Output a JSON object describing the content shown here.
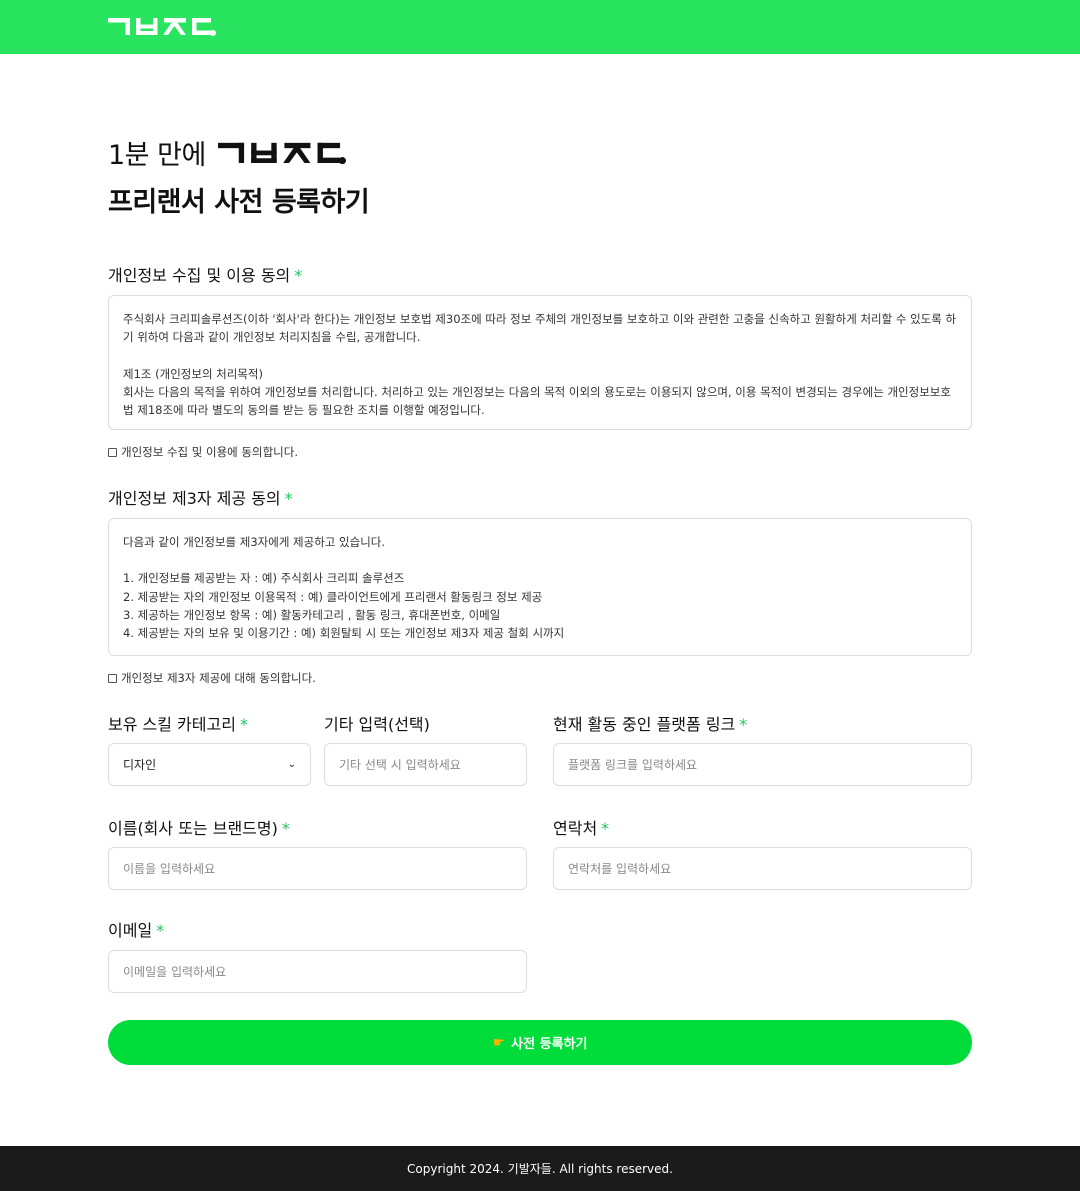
{
  "brand": {
    "logo_alt": "기발자들",
    "accent_color": "#28e45f",
    "button_color": "#00dd3a",
    "required_color": "#22c55e"
  },
  "headline": {
    "line1_prefix": "1분 만에",
    "line2": "프리랜서 사전 등록하기"
  },
  "privacy_consent": {
    "title": "개인정보 수집 및 이용 동의",
    "required_mark": "*",
    "text": "주식회사 크리피솔루션즈(이하 '회사'라 한다)는 개인정보 보호법 제30조에 따라 정보 주체의 개인정보를 보호하고 이와 관련한 고충을 신속하고 원활하게 처리할 수 있도록 하기 위하여 다음과 같이 개인정보 처리지침을 수립, 공개합니다.\n\n제1조 (개인정보의 처리목적)\n회사는 다음의 목적을 위하여 개인정보를 처리합니다. 처리하고 있는 개인정보는 다음의 목적 이외의 용도로는 이용되지 않으며, 이용 목적이 변경되는 경우에는 개인정보보호법 제18조에 따라 별도의 동의를 받는 등 필요한 조치를 이행할 예정입니다.",
    "checkbox_label": "개인정보 수집 및 이용에 동의합니다."
  },
  "third_party_consent": {
    "title": "개인정보 제3자 제공 동의",
    "required_mark": "*",
    "text": "다음과 같이 개인정보를 제3자에게 제공하고 있습니다.\n\n1. 개인정보를 제공받는 자 : 예) 주식회사 크리피 솔루션즈\n2. 제공받는 자의 개인정보 이용목적 : 예) 클라이언트에게 프리랜서 활동링크 정보 제공\n3. 제공하는 개인정보 항목 : 예) 활동카테고리 , 활동 링크, 휴대폰번호, 이메일\n4. 제공받는 자의 보유 및 이용기간 : 예) 회원탈퇴 시 또는 개인정보 제3자 제공 철회 시까지",
    "checkbox_label": "개인정보 제3자 제공에 대해 동의합니다."
  },
  "form": {
    "skill_category": {
      "label": "보유 스킬 카테고리",
      "required_mark": "*",
      "selected": "디자인"
    },
    "other_input": {
      "label": "기타 입력(선택)",
      "placeholder": "기타 선택 시 입력하세요"
    },
    "platform_link": {
      "label": "현재 활동 중인 플랫폼 링크",
      "required_mark": "*",
      "placeholder": "플랫폼 링크를 입력하세요"
    },
    "name": {
      "label": "이름(회사 또는 브랜드명)",
      "required_mark": "*",
      "placeholder": "이름을 입력하세요"
    },
    "contact": {
      "label": "연락처",
      "required_mark": "*",
      "placeholder": "연락처를 입력하세요"
    },
    "email": {
      "label": "이메일",
      "required_mark": "*",
      "placeholder": "이메일을 입력하세요"
    }
  },
  "submit": {
    "label": "사전 등록하기",
    "icon": "pointing-hand-icon"
  },
  "footer": {
    "text": "Copyright 2024. 기발자들. All rights reserved."
  }
}
